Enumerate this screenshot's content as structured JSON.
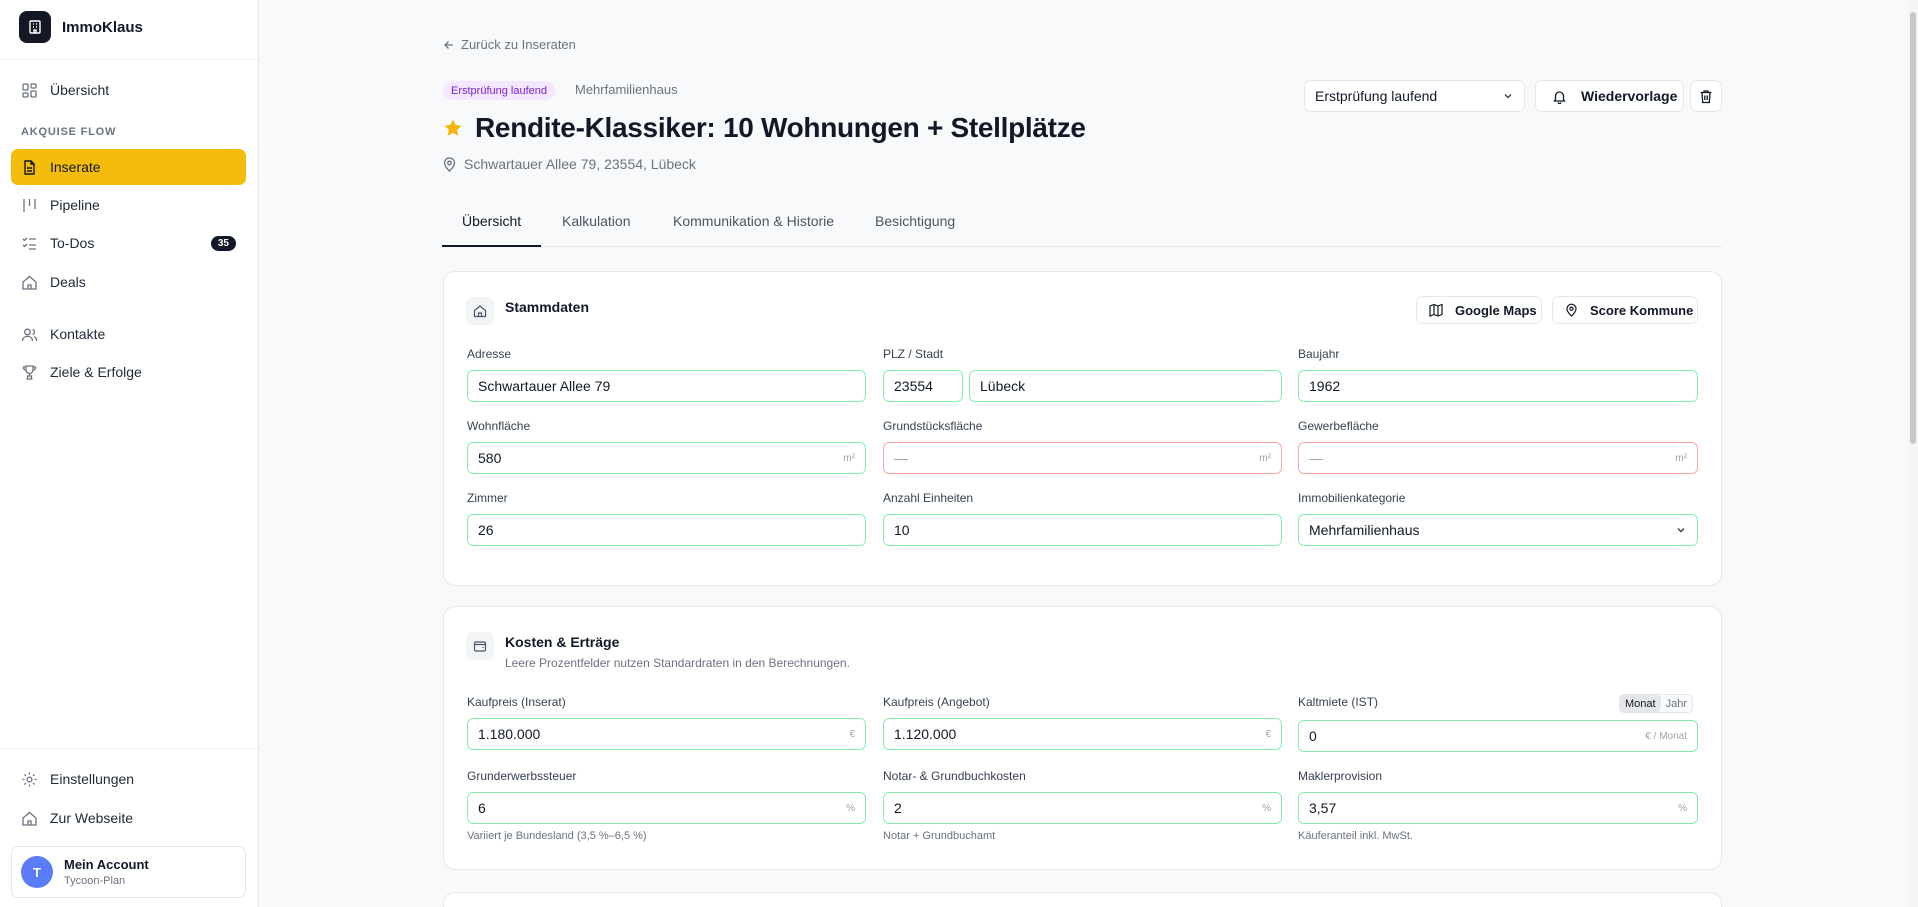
{
  "app": {
    "name": "ImmoKlaus"
  },
  "sidebar": {
    "section_label": "AKQUISE FLOW",
    "items": [
      {
        "label": "Übersicht"
      },
      {
        "label": "Inserate"
      },
      {
        "label": "Pipeline"
      },
      {
        "label": "To-Dos",
        "badge": "35"
      },
      {
        "label": "Deals"
      },
      {
        "label": "Kontakte"
      },
      {
        "label": "Ziele & Erfolge"
      }
    ],
    "footer_items": [
      {
        "label": "Einstellungen"
      },
      {
        "label": "Zur Webseite"
      }
    ],
    "account": {
      "initial": "T",
      "name": "Mein Account",
      "plan": "Tycoon-Plan"
    }
  },
  "header": {
    "back_link": "Zurück zu Inseraten",
    "status_tag": "Erstprüfung laufend",
    "type_tag": "Mehrfamilienhaus",
    "title": "Rendite-Klassiker: 10 Wohnungen + Stellplätze",
    "address": "Schwartauer Allee 79, 23554, Lübeck",
    "status_select": "Erstprüfung laufend",
    "reminder_button": "Wiedervorlage"
  },
  "tabs": [
    {
      "label": "Übersicht"
    },
    {
      "label": "Kalkulation"
    },
    {
      "label": "Kommunikation & Historie"
    },
    {
      "label": "Besichtigung"
    }
  ],
  "stammdaten": {
    "title": "Stammdaten",
    "maps_button": "Google Maps",
    "score_button": "Score Kommune",
    "labels": {
      "adresse": "Adresse",
      "plz_stadt": "PLZ / Stadt",
      "baujahr": "Baujahr",
      "wohnflaeche": "Wohnfläche",
      "grundstueck": "Grundstücksfläche",
      "gewerbe": "Gewerbefläche",
      "zimmer": "Zimmer",
      "einheiten": "Anzahl Einheiten",
      "kategorie": "Immobilienkategorie"
    },
    "values": {
      "adresse": "Schwartauer Allee 79",
      "plz": "23554",
      "stadt": "Lübeck",
      "baujahr": "1962",
      "wohnflaeche": "580",
      "grundstueck": "—",
      "gewerbe": "—",
      "zimmer": "26",
      "einheiten": "10",
      "kategorie": "Mehrfamilienhaus"
    },
    "unit_area": "m²"
  },
  "kosten": {
    "title": "Kosten & Erträge",
    "subtitle": "Leere Prozentfelder nutzen Standardraten in den Berechnungen.",
    "labels": {
      "kaufpreis_inserat": "Kaufpreis (Inserat)",
      "kaufpreis_angebot": "Kaufpreis (Angebot)",
      "kaltmiete": "Kaltmiete (IST)",
      "grunderwerb": "Grunderwerbssteuer",
      "notar": "Notar- & Grundbuchkosten",
      "makler": "Maklerprovision"
    },
    "values": {
      "kaufpreis_inserat": "1.180.000",
      "kaufpreis_angebot": "1.120.000",
      "kaltmiete": "0",
      "grunderwerb": "6",
      "notar": "2",
      "makler": "3,57"
    },
    "units": {
      "euro": "€",
      "euro_month": "€ / Monat",
      "percent": "%"
    },
    "toggle": {
      "monat": "Monat",
      "jahr": "Jahr"
    },
    "hints": {
      "grunderwerb": "Variiert je Bundesland (3,5 %–6,5 %)",
      "notar": "Notar + Grundbuchamt",
      "makler": "Käuferanteil inkl. MwSt."
    }
  }
}
